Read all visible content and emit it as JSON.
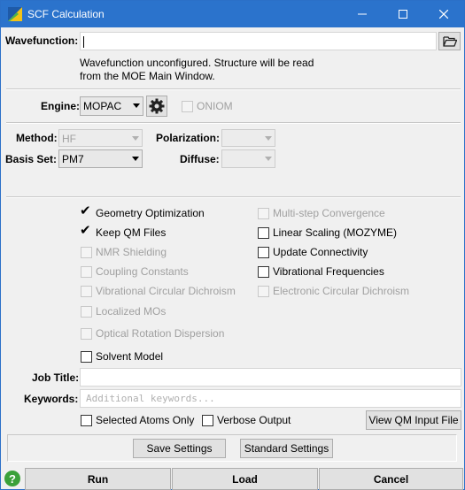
{
  "window": {
    "title": "SCF Calculation",
    "controls": {
      "minimize": "minimize-icon",
      "maximize": "maximize-icon",
      "close": "close-icon"
    }
  },
  "wavefunction": {
    "label": "Wavefunction:",
    "value": "",
    "info_line1": "Wavefunction unconfigured. Structure will be read",
    "info_line2": "from the MOE Main Window."
  },
  "engine": {
    "label": "Engine:",
    "value": "MOPAC",
    "oniom_label": "ONIOM"
  },
  "method": {
    "method_label": "Method:",
    "method_value": "HF",
    "polarization_label": "Polarization:",
    "polarization_value": "",
    "basis_label": "Basis Set:",
    "basis_value": "PM7",
    "diffuse_label": "Diffuse:",
    "diffuse_value": ""
  },
  "options": {
    "geometry_optimization": "Geometry Optimization",
    "keep_qm_files": "Keep QM Files",
    "nmr_shielding": "NMR Shielding",
    "coupling_constants": "Coupling Constants",
    "vcd": "Vibrational Circular Dichroism",
    "localized_mos": "Localized MOs",
    "ord": "Optical Rotation Dispersion",
    "solvent_model": "Solvent Model",
    "multistep": "Multi-step Convergence",
    "linear_scaling": "Linear Scaling (MOZYME)",
    "update_connectivity": "Update Connectivity",
    "vib_frequencies": "Vibrational Frequencies",
    "ecd": "Electronic Circular Dichroism"
  },
  "job": {
    "title_label": "Job Title:",
    "title_value": "",
    "keywords_label": "Keywords:",
    "keywords_placeholder": "Additional keywords...",
    "selected_atoms_only": "Selected Atoms Only",
    "verbose_output": "Verbose Output",
    "view_input": "View QM Input File"
  },
  "settings": {
    "save": "Save Settings",
    "standard": "Standard Settings"
  },
  "actions": {
    "help": "?",
    "run": "Run",
    "load": "Load",
    "cancel": "Cancel"
  },
  "colors": {
    "titlebar": "#2b73cc",
    "help_green": "#3aa13a",
    "disabled_text": "#a0a0a0"
  }
}
